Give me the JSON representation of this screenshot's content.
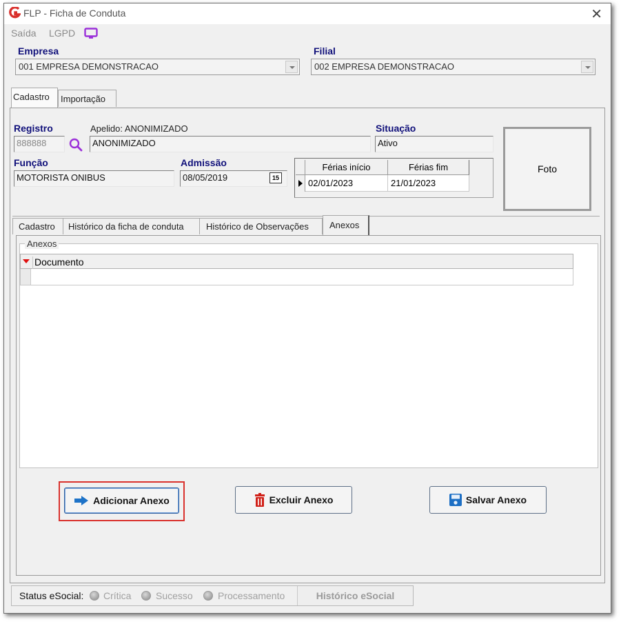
{
  "window": {
    "title": "FLP - Ficha de Conduta"
  },
  "menu": {
    "items": [
      "Saída",
      "LGPD"
    ]
  },
  "empresa": {
    "label": "Empresa",
    "value": "001 EMPRESA DEMONSTRACAO"
  },
  "filial": {
    "label": "Filial",
    "value": "002 EMPRESA DEMONSTRACAO"
  },
  "top_tabs": [
    "Cadastro",
    "Importação"
  ],
  "registro": {
    "label": "Registro",
    "value": "888888"
  },
  "apelido": {
    "label": "Apelido: ANONIMIZADO",
    "value": "ANONIMIZADO"
  },
  "situacao": {
    "label": "Situação",
    "value": "Ativo"
  },
  "funcao": {
    "label": "Função",
    "value": "MOTORISTA ONIBUS"
  },
  "admissao": {
    "label": "Admissão",
    "value": "08/05/2019",
    "calendar_glyph": "15"
  },
  "ferias": {
    "headers": [
      "Férias início",
      "Férias fim"
    ],
    "row": [
      "02/01/2023",
      "21/01/2023"
    ]
  },
  "foto": {
    "label": "Foto"
  },
  "inner_tabs": [
    "Cadastro",
    "Histórico da ficha de conduta",
    "Histórico de Observações",
    "Anexos"
  ],
  "anexos": {
    "group_label": "Anexos",
    "column": "Documento"
  },
  "buttons": {
    "add": "Adicionar Anexo",
    "delete": "Excluir Anexo",
    "save": "Salvar Anexo"
  },
  "status": {
    "label": "Status eSocial:",
    "options": [
      "Crítica",
      "Sucesso",
      "Processamento"
    ],
    "history_button": "Histórico eSocial"
  },
  "colors": {
    "accent_blue": "#10107a",
    "highlight_red": "#d9302c",
    "lgpd_purple": "#9b30d9"
  }
}
